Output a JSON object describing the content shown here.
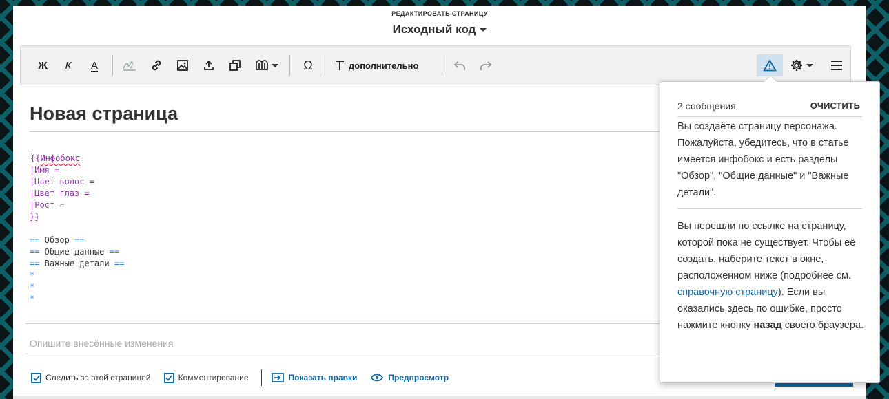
{
  "header": {
    "kicker": "РЕДАКТИРОВАТЬ СТРАНИЦУ",
    "mode": "Исходный код"
  },
  "toolbar": {
    "bold": "Ж",
    "italic": "К",
    "underline": "А",
    "special_chars": "Ω",
    "advanced": "дополнительно",
    "icons": [
      "bold-icon",
      "italic-icon",
      "text-color-icon",
      "signature-icon",
      "link-icon",
      "image-icon",
      "upload-icon",
      "gallery-icon",
      "templates-icon",
      "omega-icon",
      "advanced-format-icon",
      "undo-icon",
      "redo-icon",
      "warning-icon",
      "gear-icon",
      "menu-icon"
    ]
  },
  "page": {
    "title": "Новая страница"
  },
  "code": {
    "l1_brace": "{{",
    "l1_link": "Инфобокс",
    "l2": "|Имя =",
    "l3": "|Цвет волос =",
    "l4": "|Цвет глаз =",
    "l5": "|Рост =",
    "l6": "}}",
    "h1_open": "==",
    "h1_text": " Обзор ",
    "h1_close": "==",
    "h2_open": "==",
    "h2_text": " Общие данные ",
    "h2_close": "==",
    "h3_open": "==",
    "h3_text": " Важные детали ",
    "h3_close": "==",
    "bullet": "*"
  },
  "summary": {
    "placeholder": "Опишите внесённые изменения"
  },
  "options": {
    "watch": "Следить за этой страницей",
    "comments": "Комментирование",
    "show_changes": "Показать правки",
    "preview": "Предпросмотр"
  },
  "popover": {
    "count": "2 сообщения",
    "clear": "ОЧИСТИТЬ",
    "msg1": "Вы создаёте страницу персонажа. Пожалуйста, убедитесь, что в статье имеется инфобокс и есть разделы \"Обзор\", \"Общие данные\" и \"Важные детали\".",
    "msg2_a": "Вы перешли по ссылке на страницу, которой пока не существует. Чтобы её создать, наберите текст в окне, расположенном ниже (подробнее см. ",
    "msg2_link": "справочную страницу",
    "msg2_b": "). Если вы оказались здесь по ошибке, просто нажмите кнопку ",
    "msg2_bold": "назад",
    "msg2_c": " своего браузера."
  },
  "colors": {
    "accent": "#106ba3",
    "template": "#8b2ea8",
    "heading_markup": "#3a7fd0",
    "warning_bg": "#cfe1ee"
  }
}
